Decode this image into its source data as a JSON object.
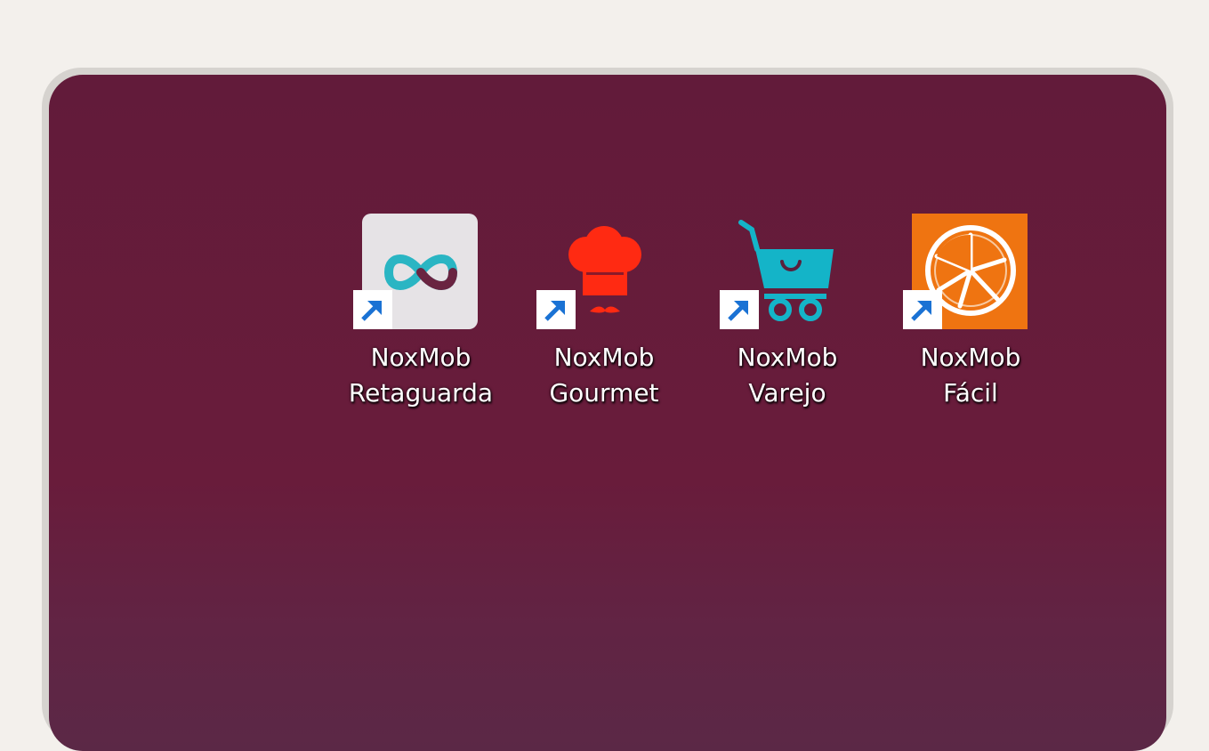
{
  "desktop": {
    "background_color": "#661c3b",
    "shortcuts": [
      {
        "line1": "NoxMob",
        "line2": "Retaguarda",
        "icon": "infinity-icon",
        "color": "#2bb6c4"
      },
      {
        "line1": "NoxMob",
        "line2": "Gourmet",
        "icon": "chef-hat-icon",
        "color": "#ff2a12"
      },
      {
        "line1": "NoxMob",
        "line2": "Varejo",
        "icon": "shopping-cart-icon",
        "color": "#14b4c8"
      },
      {
        "line1": "NoxMob",
        "line2": "Fácil",
        "icon": "citrus-slice-icon",
        "color": "#ef7411"
      }
    ],
    "shortcut_overlay_icon": "shortcut-arrow-icon"
  }
}
